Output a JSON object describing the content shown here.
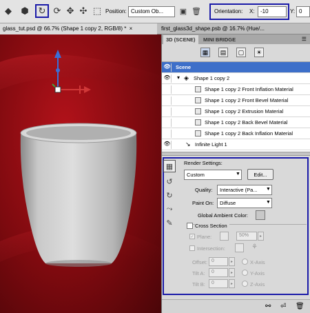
{
  "toolbar": {
    "position_label": "Position:",
    "position_value": "Custom Ob...",
    "orientation_label": "Orientation:",
    "x_label": "X:",
    "x_value": "-10",
    "y_label": "Y:",
    "y_value": "0"
  },
  "doc_tabs": [
    {
      "label": "glass_tut.psd @ 66.7% (Shape 1 copy 2, RGB/8) *",
      "close": "×"
    },
    {
      "label": "first_glass3d_shape.psb @ 16.7% (Hue/..."
    }
  ],
  "panel": {
    "tabs": [
      "3D (SCENE)",
      "MINI BRIDGE"
    ],
    "menu_icon": "☰",
    "layers": [
      {
        "label": "Scene",
        "selected": true
      },
      {
        "label": "Shape 1 copy 2"
      },
      {
        "label": "Shape 1 copy 2 Front Inflation Material"
      },
      {
        "label": "Shape 1 copy 2 Front Bevel Material"
      },
      {
        "label": "Shape 1 copy 2 Extrusion Material"
      },
      {
        "label": "Shape 1 copy 2 Back Bevel Material"
      },
      {
        "label": "Shape 1 copy 2 Back Inflation Material"
      },
      {
        "label": "Infinite Light 1"
      }
    ],
    "render_settings": {
      "title": "Render Settings:",
      "preset": "Custom",
      "edit_button": "Edit...",
      "quality_label": "Quality:",
      "quality_value": "Interactive (Pa...",
      "paint_on_label": "Paint On:",
      "paint_on_value": "Diffuse",
      "global_ambient_label": "Global Ambient Color:",
      "cross_section_label": "Cross Section",
      "plane_label": "Plane:",
      "plane_value": "50%",
      "intersection_label": "Intersection:",
      "offset_label": "Offset:",
      "offset_value": "0",
      "tilt_a_label": "Tilt A:",
      "tilt_a_value": "0",
      "tilt_b_label": "Tilt B:",
      "tilt_b_value": "0",
      "x_axis": "X-Axis",
      "y_axis": "Y-Axis",
      "z_axis": "Z-Axis"
    }
  },
  "colors": {
    "highlight": "#1a1aa8",
    "selection": "#3d6fc9",
    "canvas_red": "#9b0f16"
  }
}
